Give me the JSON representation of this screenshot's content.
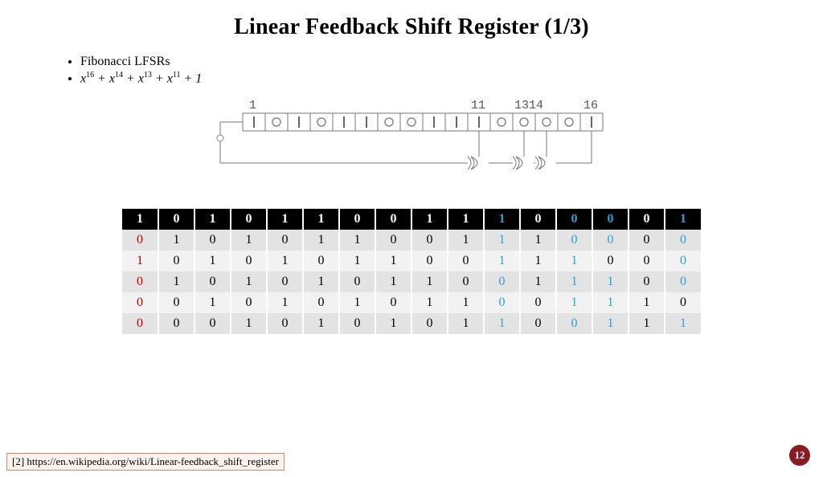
{
  "title": "Linear Feedback Shift Register (1/3)",
  "bullets": {
    "item1": "Fibonacci LFSRs",
    "poly_terms": [
      "x",
      "16",
      " + ",
      "x",
      "14",
      " + ",
      "x",
      "13",
      " + ",
      "x",
      "11",
      " + 1"
    ]
  },
  "diagram": {
    "tap_labels": [
      "1",
      "11",
      "13",
      "14",
      "16"
    ],
    "tap_positions": [
      1,
      11,
      13,
      14,
      16
    ],
    "n_cells": 16,
    "cell_states": [
      1,
      0,
      1,
      0,
      1,
      1,
      0,
      0,
      1,
      1,
      1,
      0,
      0,
      0,
      0,
      1
    ]
  },
  "table": {
    "cols": 16,
    "header": {
      "vals": [
        "1",
        "0",
        "1",
        "0",
        "1",
        "1",
        "0",
        "0",
        "1",
        "1",
        "1",
        "0",
        "0",
        "0",
        "0",
        "1"
      ],
      "colors": [
        "w",
        "w",
        "w",
        "w",
        "w",
        "w",
        "w",
        "w",
        "w",
        "w",
        "b",
        "w",
        "b",
        "b",
        "w",
        "b"
      ]
    },
    "rows": [
      {
        "vals": [
          "0",
          "1",
          "0",
          "1",
          "0",
          "1",
          "1",
          "0",
          "0",
          "1",
          "1",
          "1",
          "0",
          "0",
          "0",
          "0"
        ],
        "colors": [
          "r",
          "",
          "",
          "",
          "",
          "",
          "",
          "",
          "",
          "",
          "b",
          "",
          "b",
          "b",
          "",
          "b"
        ]
      },
      {
        "vals": [
          "1",
          "0",
          "1",
          "0",
          "1",
          "0",
          "1",
          "1",
          "0",
          "0",
          "1",
          "1",
          "1",
          "0",
          "0",
          "0"
        ],
        "colors": [
          "r",
          "",
          "",
          "",
          "",
          "",
          "",
          "",
          "",
          "",
          "b",
          "",
          "b",
          "",
          "",
          "b"
        ]
      },
      {
        "vals": [
          "0",
          "1",
          "0",
          "1",
          "0",
          "1",
          "0",
          "1",
          "1",
          "0",
          "0",
          "1",
          "1",
          "1",
          "0",
          "0"
        ],
        "colors": [
          "r",
          "",
          "",
          "",
          "",
          "",
          "",
          "",
          "",
          "",
          "b",
          "",
          "b",
          "b",
          "",
          "b"
        ]
      },
      {
        "vals": [
          "0",
          "0",
          "1",
          "0",
          "1",
          "0",
          "1",
          "0",
          "1",
          "1",
          "0",
          "0",
          "1",
          "1",
          "1",
          "0"
        ],
        "colors": [
          "r",
          "",
          "",
          "",
          "",
          "",
          "",
          "",
          "",
          "",
          "b",
          "",
          "b",
          "b",
          "",
          ""
        ]
      },
      {
        "vals": [
          "0",
          "0",
          "0",
          "1",
          "0",
          "1",
          "0",
          "1",
          "0",
          "1",
          "1",
          "0",
          "0",
          "1",
          "1",
          "1"
        ],
        "colors": [
          "r",
          "",
          "",
          "",
          "",
          "",
          "",
          "",
          "",
          "",
          "b",
          "",
          "b",
          "b",
          "",
          "b"
        ]
      }
    ]
  },
  "reference": "[2] https://en.wikipedia.org/wiki/Linear-feedback_shift_register",
  "page_number": "12",
  "colors": {
    "red": "#c00000",
    "blue": "#2aa1d3",
    "badge": "#8c1a23"
  }
}
